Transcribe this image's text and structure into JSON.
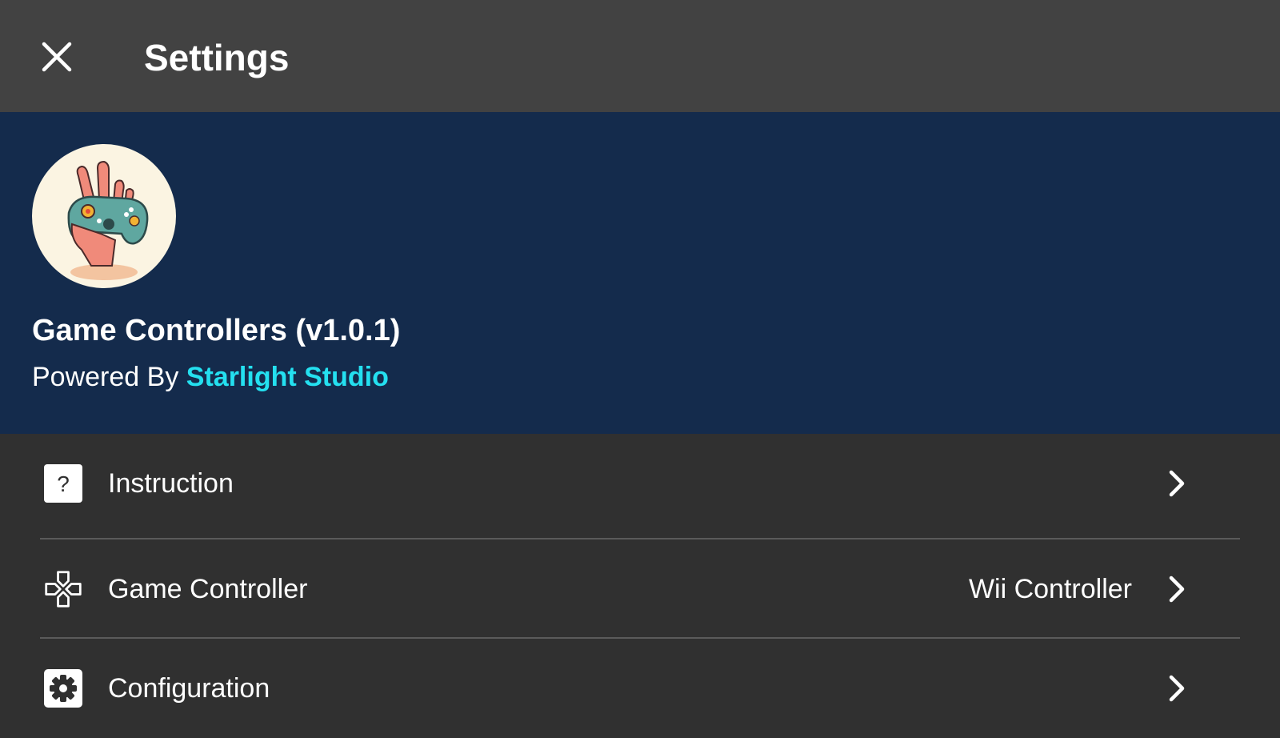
{
  "appbar": {
    "title": "Settings",
    "close_icon": "close-icon"
  },
  "banner": {
    "logo_icon": "game-controller-hand-logo",
    "app_name": "Game Controllers (v1.0.1)",
    "powered_prefix": "Powered By",
    "studio_name": "Starlight Studio"
  },
  "colors": {
    "appbar_bg": "#424242",
    "banner_bg": "#142b4c",
    "list_bg": "#303030",
    "accent": "#24e0f0",
    "divider": "#5a5a5a"
  },
  "settings": {
    "items": [
      {
        "label": "Instruction",
        "icon": "help-icon",
        "value": ""
      },
      {
        "label": "Game Controller",
        "icon": "gamepad-icon",
        "value": "Wii Controller"
      },
      {
        "label": "Configuration",
        "icon": "gear-icon",
        "value": ""
      }
    ]
  }
}
